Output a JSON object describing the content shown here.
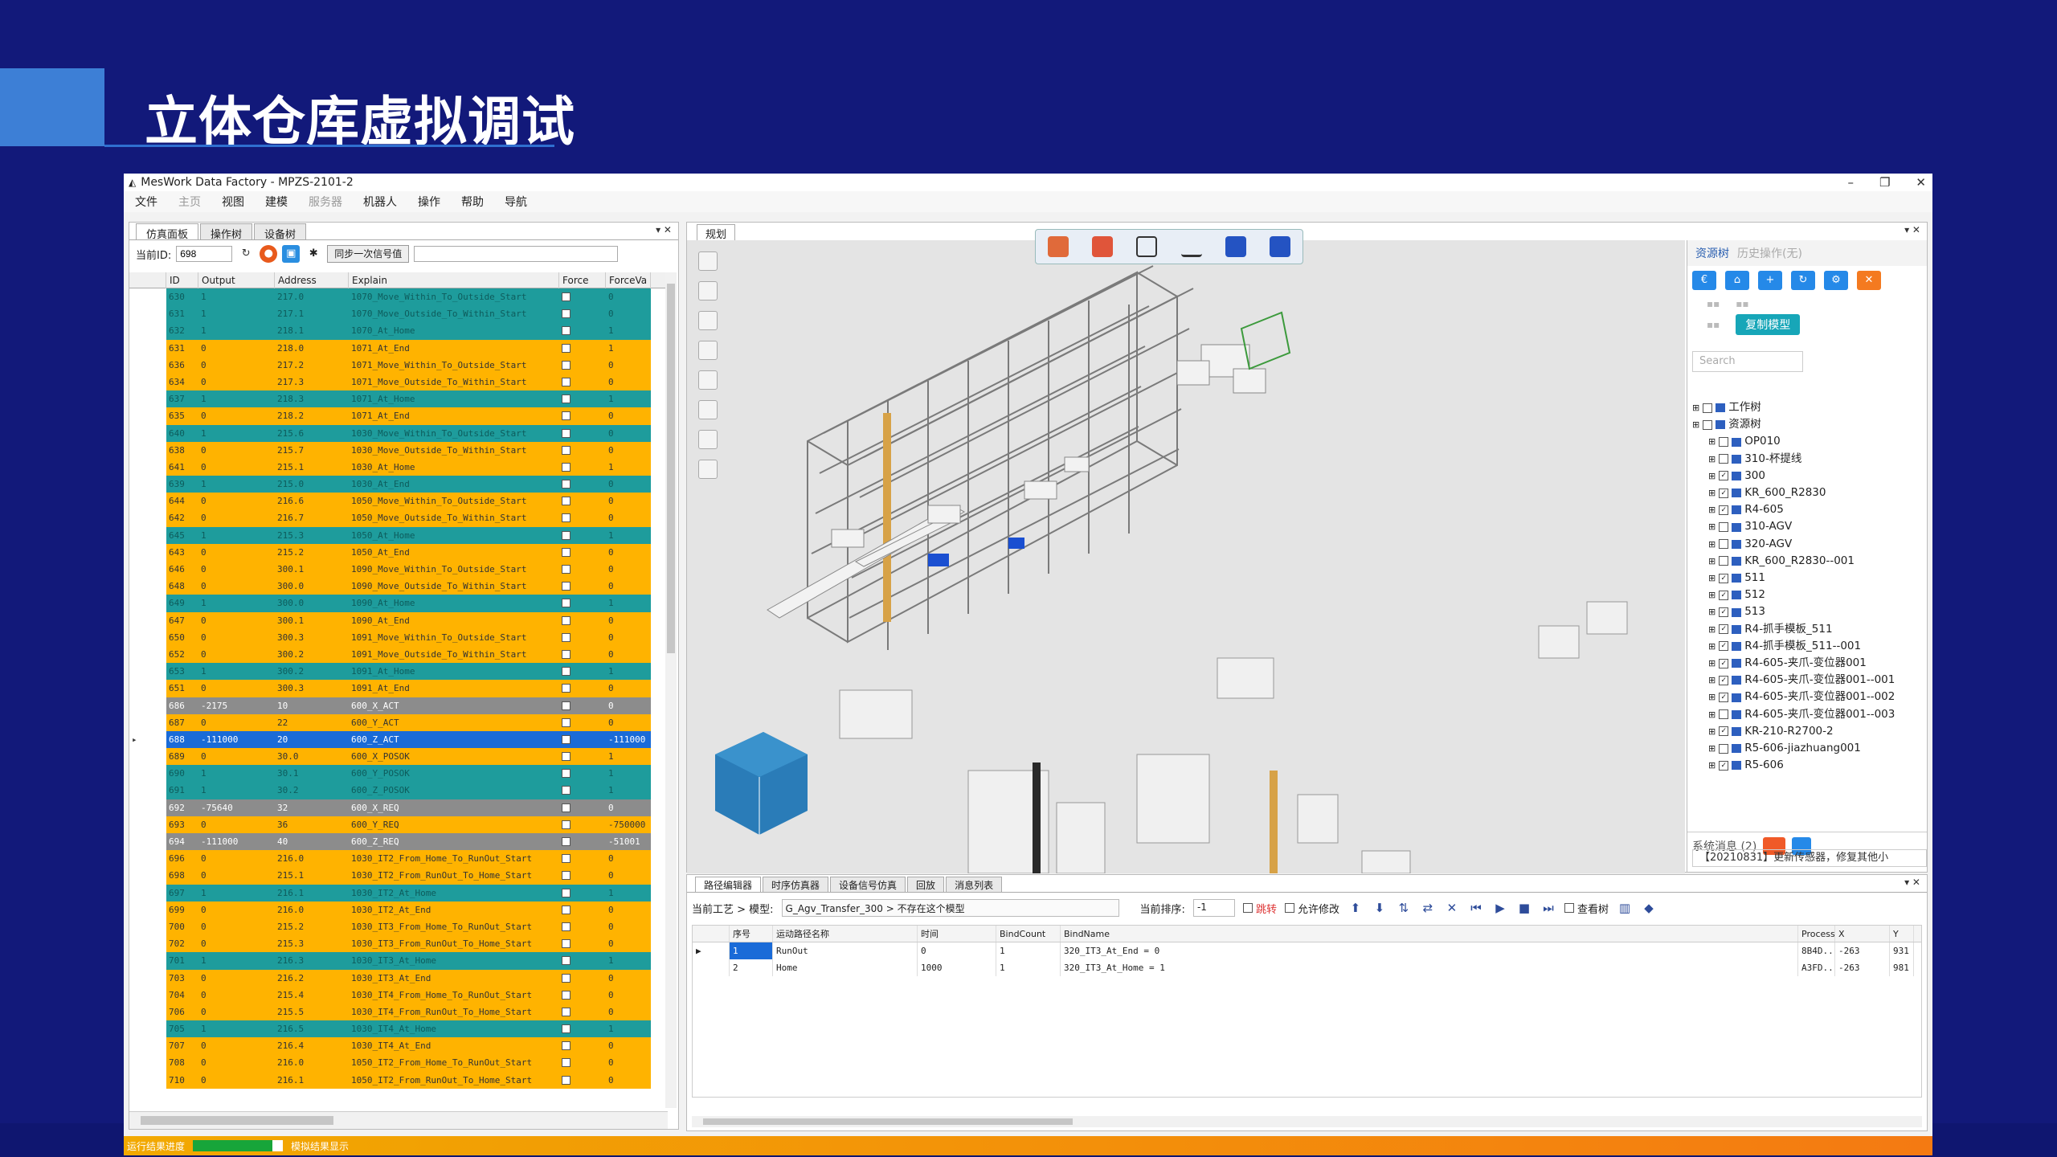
{
  "slide": {
    "title": "立体仓库虚拟调试"
  },
  "window": {
    "title": "MesWork Data Factory - MPZS-2101-2",
    "controls": [
      "–",
      "❐",
      "✕"
    ]
  },
  "menu": [
    "文件",
    "主页",
    "视图",
    "建模",
    "服务器",
    "机器人",
    "操作",
    "帮助",
    "导航"
  ],
  "left_panel": {
    "tabs": [
      "仿真面板",
      "操作树",
      "设备树"
    ],
    "current_id_label": "当前ID:",
    "current_id_value": "698",
    "sync_button": "同步一次信号值",
    "columns": [
      "ID",
      "Output",
      "Address",
      "Explain",
      "Force",
      "ForceVa"
    ],
    "rows": [
      {
        "id": "630",
        "output": "1",
        "address": "217.0",
        "explain": "1070_Move_Within_To_Outside_Start",
        "forceval": "0",
        "color": "teal"
      },
      {
        "id": "631",
        "output": "1",
        "address": "217.1",
        "explain": "1070_Move_Outside_To_Within_Start",
        "forceval": "0",
        "color": "teal"
      },
      {
        "id": "632",
        "output": "1",
        "address": "218.1",
        "explain": "1070_At_Home",
        "forceval": "1",
        "color": "teal"
      },
      {
        "id": "631",
        "output": "0",
        "address": "218.0",
        "explain": "1071_At_End",
        "forceval": "1",
        "color": "orange"
      },
      {
        "id": "636",
        "output": "0",
        "address": "217.2",
        "explain": "1071_Move_Within_To_Outside_Start",
        "forceval": "0",
        "color": "orange"
      },
      {
        "id": "634",
        "output": "0",
        "address": "217.3",
        "explain": "1071_Move_Outside_To_Within_Start",
        "forceval": "0",
        "color": "orange"
      },
      {
        "id": "637",
        "output": "1",
        "address": "218.3",
        "explain": "1071_At_Home",
        "forceval": "1",
        "color": "teal"
      },
      {
        "id": "635",
        "output": "0",
        "address": "218.2",
        "explain": "1071_At_End",
        "forceval": "0",
        "color": "orange"
      },
      {
        "id": "640",
        "output": "1",
        "address": "215.6",
        "explain": "1030_Move_Within_To_Outside_Start",
        "forceval": "0",
        "color": "teal"
      },
      {
        "id": "638",
        "output": "0",
        "address": "215.7",
        "explain": "1030_Move_Outside_To_Within_Start",
        "forceval": "0",
        "color": "orange"
      },
      {
        "id": "641",
        "output": "0",
        "address": "215.1",
        "explain": "1030_At_Home",
        "forceval": "1",
        "color": "orange"
      },
      {
        "id": "639",
        "output": "1",
        "address": "215.0",
        "explain": "1030_At_End",
        "forceval": "0",
        "color": "teal"
      },
      {
        "id": "644",
        "output": "0",
        "address": "216.6",
        "explain": "1050_Move_Within_To_Outside_Start",
        "forceval": "0",
        "color": "orange"
      },
      {
        "id": "642",
        "output": "0",
        "address": "216.7",
        "explain": "1050_Move_Outside_To_Within_Start",
        "forceval": "0",
        "color": "orange"
      },
      {
        "id": "645",
        "output": "1",
        "address": "215.3",
        "explain": "1050_At_Home",
        "forceval": "1",
        "color": "teal"
      },
      {
        "id": "643",
        "output": "0",
        "address": "215.2",
        "explain": "1050_At_End",
        "forceval": "0",
        "color": "orange"
      },
      {
        "id": "646",
        "output": "0",
        "address": "300.1",
        "explain": "1090_Move_Within_To_Outside_Start",
        "forceval": "0",
        "color": "orange"
      },
      {
        "id": "648",
        "output": "0",
        "address": "300.0",
        "explain": "1090_Move_Outside_To_Within_Start",
        "forceval": "0",
        "color": "orange"
      },
      {
        "id": "649",
        "output": "1",
        "address": "300.0",
        "explain": "1090_At_Home",
        "forceval": "1",
        "color": "teal"
      },
      {
        "id": "647",
        "output": "0",
        "address": "300.1",
        "explain": "1090_At_End",
        "forceval": "0",
        "color": "orange"
      },
      {
        "id": "650",
        "output": "0",
        "address": "300.3",
        "explain": "1091_Move_Within_To_Outside_Start",
        "forceval": "0",
        "color": "orange"
      },
      {
        "id": "652",
        "output": "0",
        "address": "300.2",
        "explain": "1091_Move_Outside_To_Within_Start",
        "forceval": "0",
        "color": "orange"
      },
      {
        "id": "653",
        "output": "1",
        "address": "300.2",
        "explain": "1091_At_Home",
        "forceval": "1",
        "color": "teal"
      },
      {
        "id": "651",
        "output": "0",
        "address": "300.3",
        "explain": "1091_At_End",
        "forceval": "0",
        "color": "orange"
      },
      {
        "id": "686",
        "output": "-2175",
        "address": "10",
        "explain": "600_X_ACT",
        "forceval": "0",
        "color": "gray"
      },
      {
        "id": "687",
        "output": "0",
        "address": "22",
        "explain": "600_Y_ACT",
        "forceval": "0",
        "color": "orange"
      },
      {
        "id": "688",
        "output": "-111000",
        "address": "20",
        "explain": "600_Z_ACT",
        "forceval": "-111000",
        "color": "blue"
      },
      {
        "id": "689",
        "output": "0",
        "address": "30.0",
        "explain": "600_X_POSOK",
        "forceval": "1",
        "color": "orange"
      },
      {
        "id": "690",
        "output": "1",
        "address": "30.1",
        "explain": "600_Y_POSOK",
        "forceval": "1",
        "color": "teal"
      },
      {
        "id": "691",
        "output": "1",
        "address": "30.2",
        "explain": "600_Z_POSOK",
        "forceval": "1",
        "color": "teal"
      },
      {
        "id": "692",
        "output": "-75640",
        "address": "32",
        "explain": "600_X_REQ",
        "forceval": "0",
        "color": "gray"
      },
      {
        "id": "693",
        "output": "0",
        "address": "36",
        "explain": "600_Y_REQ",
        "forceval": "-750000",
        "color": "orange"
      },
      {
        "id": "694",
        "output": "-111000",
        "address": "40",
        "explain": "600_Z_REQ",
        "forceval": "-51001",
        "color": "gray"
      },
      {
        "id": "696",
        "output": "0",
        "address": "216.0",
        "explain": "1030_IT2_From_Home_To_RunOut_Start",
        "forceval": "0",
        "color": "orange"
      },
      {
        "id": "698",
        "output": "0",
        "address": "215.1",
        "explain": "1030_IT2_From_RunOut_To_Home_Start",
        "forceval": "0",
        "color": "orange"
      },
      {
        "id": "697",
        "output": "1",
        "address": "216.1",
        "explain": "1030_IT2_At_Home",
        "forceval": "1",
        "color": "teal"
      },
      {
        "id": "699",
        "output": "0",
        "address": "216.0",
        "explain": "1030_IT2_At_End",
        "forceval": "0",
        "color": "orange"
      },
      {
        "id": "700",
        "output": "0",
        "address": "215.2",
        "explain": "1030_IT3_From_Home_To_RunOut_Start",
        "forceval": "0",
        "color": "orange"
      },
      {
        "id": "702",
        "output": "0",
        "address": "215.3",
        "explain": "1030_IT3_From_RunOut_To_Home_Start",
        "forceval": "0",
        "color": "orange"
      },
      {
        "id": "701",
        "output": "1",
        "address": "216.3",
        "explain": "1030_IT3_At_Home",
        "forceval": "1",
        "color": "teal"
      },
      {
        "id": "703",
        "output": "0",
        "address": "216.2",
        "explain": "1030_IT3_At_End",
        "forceval": "0",
        "color": "orange"
      },
      {
        "id": "704",
        "output": "0",
        "address": "215.4",
        "explain": "1030_IT4_From_Home_To_RunOut_Start",
        "forceval": "0",
        "color": "orange"
      },
      {
        "id": "706",
        "output": "0",
        "address": "215.5",
        "explain": "1030_IT4_From_RunOut_To_Home_Start",
        "forceval": "0",
        "color": "orange"
      },
      {
        "id": "705",
        "output": "1",
        "address": "216.5",
        "explain": "1030_IT4_At_Home",
        "forceval": "1",
        "color": "teal"
      },
      {
        "id": "707",
        "output": "0",
        "address": "216.4",
        "explain": "1030_IT4_At_End",
        "forceval": "0",
        "color": "orange"
      },
      {
        "id": "708",
        "output": "0",
        "address": "216.0",
        "explain": "1050_IT2_From_Home_To_RunOut_Start",
        "forceval": "0",
        "color": "orange"
      },
      {
        "id": "710",
        "output": "0",
        "address": "216.1",
        "explain": "1050_IT2_From_RunOut_To_Home_Start",
        "forceval": "0",
        "color": "orange"
      }
    ]
  },
  "viewport": {
    "tab": "规划"
  },
  "resources": {
    "tabs": [
      "资源树",
      "历史操作(无)"
    ],
    "copy_button": "复制模型",
    "search_placeholder": "Search",
    "tree": [
      {
        "label": "工作树",
        "indent": 0,
        "checked": false
      },
      {
        "label": "资源树",
        "indent": 0,
        "checked": false
      },
      {
        "label": "OP010",
        "indent": 2,
        "checked": false
      },
      {
        "label": "310-杯提线",
        "indent": 2,
        "checked": false
      },
      {
        "label": "300",
        "indent": 2,
        "checked": true
      },
      {
        "label": "KR_600_R2830",
        "indent": 2,
        "checked": true
      },
      {
        "label": "R4-605",
        "indent": 2,
        "checked": true
      },
      {
        "label": "310-AGV",
        "indent": 2,
        "checked": false
      },
      {
        "label": "320-AGV",
        "indent": 2,
        "checked": false
      },
      {
        "label": "KR_600_R2830--001",
        "indent": 2,
        "checked": false
      },
      {
        "label": "511",
        "indent": 2,
        "checked": true
      },
      {
        "label": "512",
        "indent": 2,
        "checked": true
      },
      {
        "label": "513",
        "indent": 2,
        "checked": true
      },
      {
        "label": "R4-抓手模板_511",
        "indent": 2,
        "checked": true
      },
      {
        "label": "R4-抓手模板_511--001",
        "indent": 2,
        "checked": true
      },
      {
        "label": "R4-605-夹爪-变位器001",
        "indent": 2,
        "checked": true
      },
      {
        "label": "R4-605-夹爪-变位器001--001",
        "indent": 2,
        "checked": true
      },
      {
        "label": "R4-605-夹爪-变位器001--002",
        "indent": 2,
        "checked": true
      },
      {
        "label": "R4-605-夹爪-变位器001--003",
        "indent": 2,
        "checked": false
      },
      {
        "label": "KR-210-R2700-2",
        "indent": 2,
        "checked": true
      },
      {
        "label": "R5-606-jiazhuang001",
        "indent": 2,
        "checked": false
      },
      {
        "label": "R5-606",
        "indent": 2,
        "checked": true
      }
    ],
    "messages_label": "系统消息 (2)",
    "message_text": "【20210831】更新传感器，修复其他小"
  },
  "bottom_panel": {
    "tabs": [
      "路径编辑器",
      "时序仿真器",
      "设备信号仿真",
      "回放",
      "消息列表"
    ],
    "process_label": "当前工艺 > 模型:",
    "process_value": "G_Agv_Transfer_300 > 不存在这个模型",
    "order_label": "当前排序:",
    "order_value": "-1",
    "check1": "跳转",
    "check2": "允许修改",
    "check3": "查看树",
    "columns": [
      "",
      "序号",
      "运动路径名称",
      "时间",
      "BindCount",
      "BindName",
      "",
      "Process",
      "X",
      "Y"
    ],
    "rows": [
      {
        "marker": "▶",
        "index": "1",
        "name": "RunOut",
        "time": "0",
        "bindcount": "1",
        "bindname": "320_IT3_At_End = 0",
        "process": "8B4D...",
        "x": "-263",
        "y": "931"
      },
      {
        "marker": "",
        "index": "2",
        "name": "Home",
        "time": "1000",
        "bindcount": "1",
        "bindname": "320_IT3_At_Home = 1",
        "process": "A3FD...",
        "x": "-263",
        "y": "981"
      }
    ]
  },
  "status_bar": {
    "left": "运行结果进度",
    "right": "模拟结果显示",
    "progress": 0.88
  }
}
